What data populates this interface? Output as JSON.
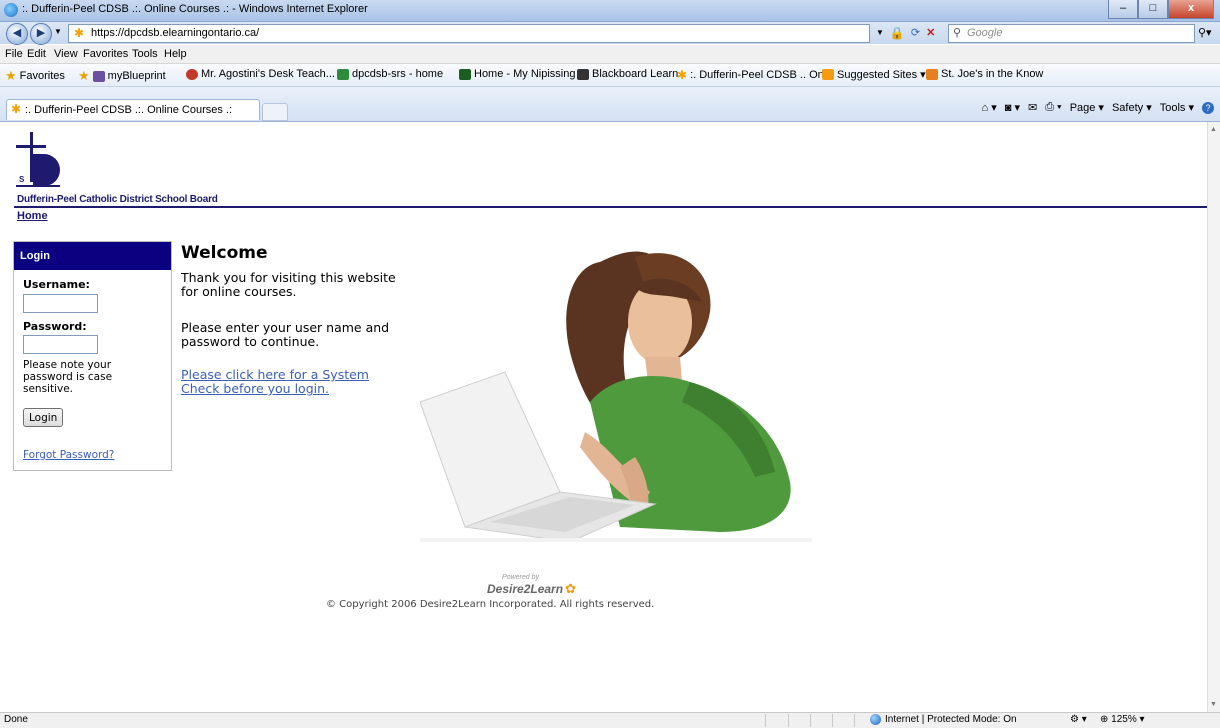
{
  "window": {
    "title": ":. Dufferin-Peel CDSB .:. Online Courses .: - Windows Internet Explorer",
    "minimize": "–",
    "maximize": "□",
    "close": "x"
  },
  "address": {
    "back": "◀",
    "forward": "▶",
    "url": "https://dpcdsb.elearningontario.ca/",
    "search_placeholder": "Google"
  },
  "menu": [
    "File",
    "Edit",
    "View",
    "Favorites",
    "Tools",
    "Help"
  ],
  "favorites_bar": {
    "favorites_label": "Favorites",
    "items": [
      "myBlueprint",
      "Mr. Agostini's Desk Teach...",
      "dpcdsb-srs - home",
      "Home - My Nipissing",
      "Blackboard Learn",
      ":. Dufferin-Peel CDSB .. On...",
      "Suggested Sites ▾",
      "St. Joe's in the Know"
    ]
  },
  "tab": {
    "title": ":. Dufferin-Peel CDSB .:. Online Courses .:"
  },
  "command_bar": {
    "page": "Page ▾",
    "safety": "Safety ▾",
    "tools": "Tools ▾"
  },
  "page": {
    "board_name": "Dufferin-Peel Catholic District School Board",
    "home_link": "Home",
    "login": {
      "header": "Login",
      "username_label": "Username:",
      "username_value": "",
      "password_label": "Password:",
      "password_value": "",
      "note": "Please note your password is case sensitive.",
      "button": "Login",
      "forgot": "Forgot Password?"
    },
    "welcome_title": "Welcome",
    "para1": "Thank you for visiting this website for online courses.",
    "para2": "Please enter your user name and password to continue.",
    "system_check_link": "Please click here for a System Check before you login.",
    "powered_by": "Powered by",
    "d2l_brand": "Desire2Learn",
    "copyright": "© Copyright 2006 Desire2Learn Incorporated. All rights reserved."
  },
  "status": {
    "left": "Done",
    "zone": "Internet | Protected Mode: On",
    "zoom": "125%"
  }
}
